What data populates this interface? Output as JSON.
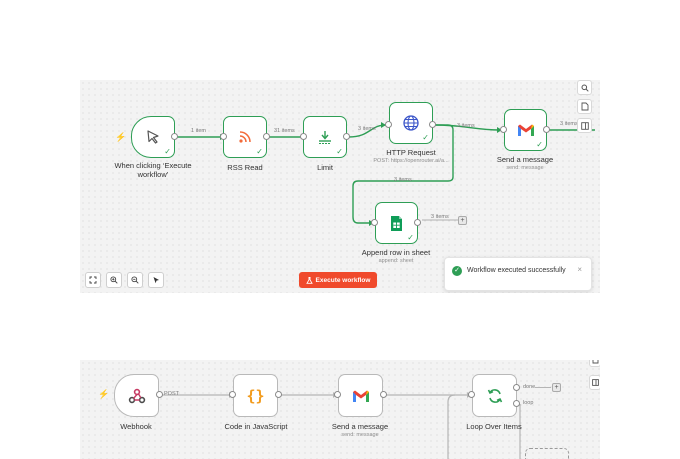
{
  "workflow1": {
    "nodes": {
      "trigger": {
        "label": "When clicking ‘Execute workflow’",
        "icon": "cursor-icon"
      },
      "rss": {
        "label": "RSS Read",
        "icon": "rss-icon"
      },
      "limit": {
        "label": "Limit",
        "icon": "limit-icon"
      },
      "http": {
        "label": "HTTP Request",
        "sub": "POST: https://openrouter.ai/a...",
        "icon": "globe-icon"
      },
      "gmail": {
        "label": "Send a message",
        "sub": "send: message",
        "icon": "gmail-icon"
      },
      "sheets": {
        "label": "Append row in sheet",
        "sub": "append: sheet",
        "icon": "google-sheets-icon"
      }
    },
    "counts": {
      "trigger_rss": "1 item",
      "rss_limit": "31 items",
      "limit_http": "3 items",
      "http_gmail": "3 items",
      "gmail_out": "3 items",
      "http_sheets": "3 items",
      "sheets_out": "3 items"
    },
    "execute_button": "Execute workflow",
    "toast": {
      "message": "Workflow executed successfully",
      "close": "×"
    },
    "side_toolbar": [
      "search-icon",
      "page-icon",
      "panel-icon"
    ],
    "zoom_toolbar": [
      "fit-view-icon",
      "zoom-in-icon",
      "zoom-out-icon",
      "pointer-icon"
    ]
  },
  "workflow2": {
    "nodes": {
      "webhook": {
        "label": "Webhook",
        "icon": "webhook-icon"
      },
      "code": {
        "label": "Code in JavaScript",
        "icon": "code-braces-icon"
      },
      "gmail": {
        "label": "Send a message",
        "sub": "send: message",
        "icon": "gmail-icon"
      },
      "loop": {
        "label": "Loop Over Items",
        "icon": "loop-icon"
      }
    },
    "connection_label": "POST",
    "loop_outputs": {
      "done": "done",
      "loop": "loop"
    }
  },
  "colors": {
    "success": "#2e9e55",
    "accent": "#f04a2c",
    "canvas": "#f3f3f3"
  }
}
